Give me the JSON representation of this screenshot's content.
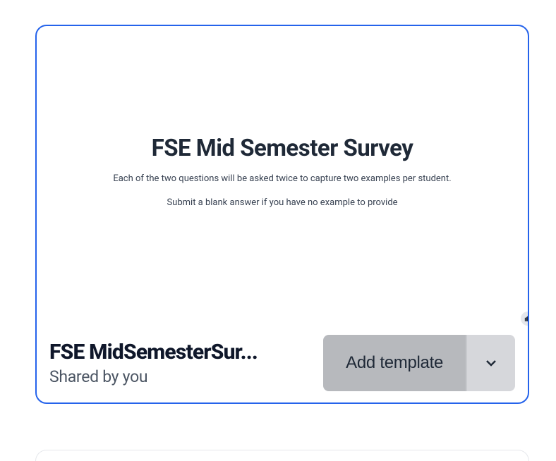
{
  "card": {
    "preview": {
      "title": "FSE Mid Semester Survey",
      "desc_line1": "Each of the two questions will be asked twice to capture two examples per student.",
      "desc_line2": "Submit a blank answer if you have no example to provide"
    },
    "footer": {
      "title": "FSE MidSemesterSur...",
      "subtitle": "Shared by you",
      "add_button_label": "Add template"
    }
  }
}
